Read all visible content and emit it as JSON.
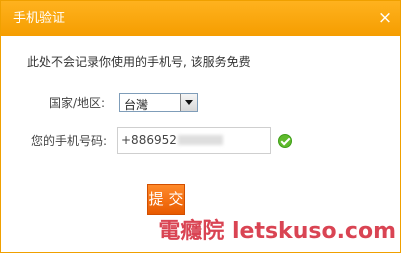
{
  "dialog": {
    "title": "手机验证",
    "close_label": "×"
  },
  "notice": "此处不会记录你使用的手机号, 该服务免费",
  "form": {
    "region_label": "国家/地区:",
    "region_value": "台灣",
    "phone_label": "您的手机号码:",
    "phone_value": "+886952"
  },
  "submit_label": "提 交",
  "watermark": "電癮院 letskuso.com",
  "colors": {
    "title_bar": "#f7a300",
    "button": "#f06a10",
    "success": "#5fba2c"
  },
  "icons": {
    "close": "close-icon",
    "dropdown": "chevron-down-icon",
    "valid": "check-circle-icon"
  }
}
